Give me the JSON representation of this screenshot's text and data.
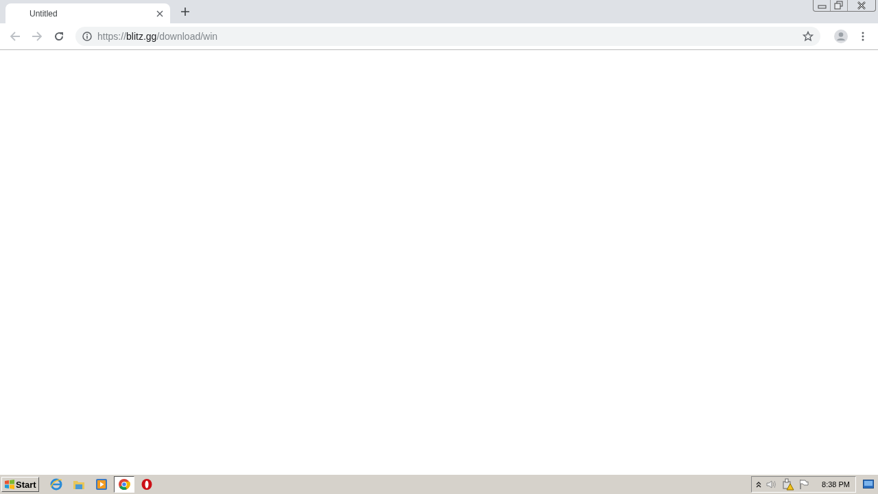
{
  "tabs": [
    {
      "title": "Untitled",
      "selected": true
    }
  ],
  "address_bar": {
    "scheme": "https://",
    "host": "blitz.gg",
    "path": "/download/win"
  },
  "taskbar": {
    "start_label": "Start",
    "apps": [
      {
        "kind": "ie",
        "selected": false
      },
      {
        "kind": "folder",
        "selected": false
      },
      {
        "kind": "media",
        "selected": false
      },
      {
        "kind": "chrome",
        "selected": true
      },
      {
        "kind": "opera",
        "selected": false
      }
    ],
    "clock": "8:38 PM"
  }
}
